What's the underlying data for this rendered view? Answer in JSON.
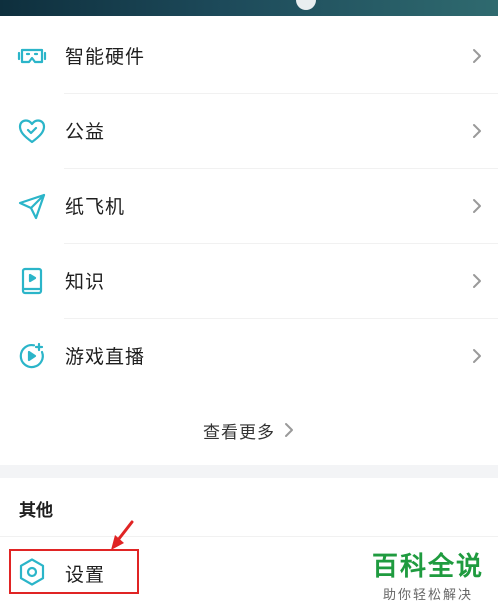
{
  "colors": {
    "accent": "#2bb5c9",
    "highlight": "#e02424",
    "watermark": "#1f9b3f"
  },
  "menu": {
    "items": [
      {
        "label": "智能硬件",
        "icon": "vr-headset-icon"
      },
      {
        "label": "公益",
        "icon": "heart-hands-icon"
      },
      {
        "label": "纸飞机",
        "icon": "paper-plane-icon"
      },
      {
        "label": "知识",
        "icon": "book-video-icon"
      },
      {
        "label": "游戏直播",
        "icon": "game-live-icon"
      }
    ],
    "more_label": "查看更多"
  },
  "other": {
    "section_title": "其他",
    "settings_label": "设置",
    "settings_icon": "hexagon-gear-icon"
  },
  "watermark": {
    "title": "百科全说",
    "subtitle": "助你轻松解决"
  }
}
